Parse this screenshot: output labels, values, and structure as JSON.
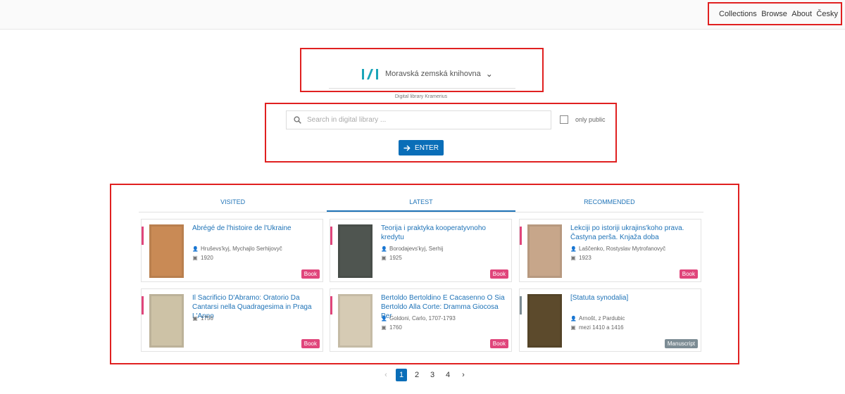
{
  "nav": {
    "items": [
      "Collections",
      "Browse",
      "About",
      "Česky"
    ]
  },
  "brand": {
    "library_name": "Moravská zemská knihovna",
    "subtitle": "Digital library Kramerius"
  },
  "search": {
    "placeholder": "Search in digital library ...",
    "only_public_label": "only public",
    "enter_label": "ENTER"
  },
  "tabs": [
    {
      "label": "VISITED"
    },
    {
      "label": "LATEST",
      "active": true
    },
    {
      "label": "RECOMMENDED"
    }
  ],
  "cards": [
    {
      "title": "Abrégé de l'histoire de l'Ukraine",
      "author": "Hruševs'kyj, Mychajlo Serhijovyč",
      "date": "1920",
      "badge": "Book",
      "badge_color": "#e0457b",
      "accent": "#e0457b",
      "thumb_color": "#c98a55"
    },
    {
      "title": "Teorija i praktyka kooperatyvnoho kredytu",
      "author": "Borodajevs'kyj, Serhij",
      "date": "1925",
      "badge": "Book",
      "badge_color": "#e0457b",
      "accent": "#e0457b",
      "thumb_color": "#4f5550"
    },
    {
      "title": "Lekciji po istoriji ukrajins'koho prava. Častyna perša. Knjaža doba",
      "author": "Laščenko, Rostyslav Mytrofanovyč",
      "date": "1923",
      "badge": "Book",
      "badge_color": "#e0457b",
      "accent": "#e0457b",
      "thumb_color": "#c7a68a"
    },
    {
      "title": "Il Sacrificio D'Abramo: Oratorio Da Cantarsi nella Quadragesima in Praga L'Anno",
      "author": "",
      "date": "1756",
      "badge": "Book",
      "badge_color": "#e0457b",
      "accent": "#e0457b",
      "thumb_color": "#cdc2a6"
    },
    {
      "title": "Bertoldo Bertoldino E Cacasenno O Sia Bertoldo Alla Corte: Dramma Giocosa Per",
      "author": "Goldoni, Carlo, 1707-1793",
      "date": "1760",
      "badge": "Book",
      "badge_color": "#e0457b",
      "accent": "#e0457b",
      "thumb_color": "#d6cbb4"
    },
    {
      "title": "[Statuta synodalia]",
      "author": "Arnošt, z Pardubic",
      "date": "mezi 1410 a 1416",
      "badge": "Manuscript",
      "badge_color": "#7c8c94",
      "accent": "#7c8c94",
      "thumb_color": "#5c4a2c"
    }
  ],
  "pagination": {
    "pages": [
      "1",
      "2",
      "3",
      "4"
    ],
    "current": "1",
    "prev": "‹",
    "next": "›"
  }
}
